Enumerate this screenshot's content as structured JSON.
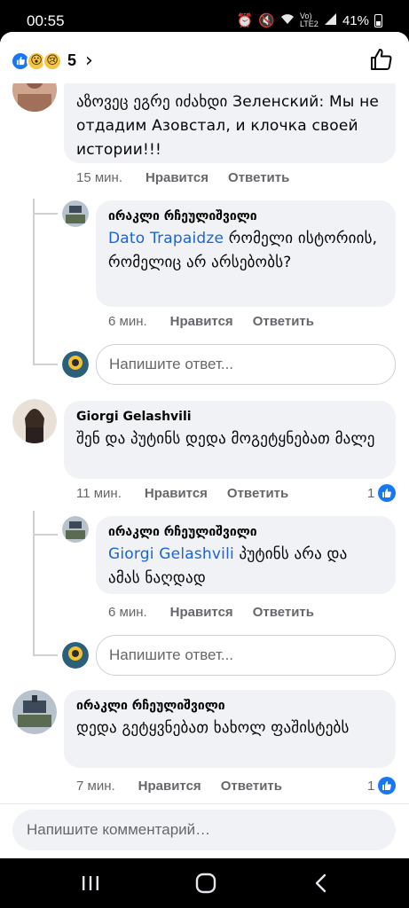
{
  "status": {
    "time": "00:55",
    "battery": "41%",
    "network": "Vo) LTE2"
  },
  "header": {
    "reaction_count": "5",
    "chevron": "›"
  },
  "comments": [
    {
      "text": "აზოვეც ეგრე იძახდი Зеленский: Мы не отдадим Азовстал, и клочка своей истории!!!",
      "time": "15 мин.",
      "like": "Нравится",
      "reply": "Ответить"
    },
    {
      "author": "ირაკლი რჩეულიშვილი",
      "mention": "Dato Trapaidze",
      "text": " რომელი ისტორიის, რომელიც არ არსებობს?",
      "time": "6 мин.",
      "like": "Нравится",
      "reply": "Ответить"
    },
    {
      "author": "Giorgi Gelashvili",
      "text": "შენ და პუტინს დედა მოგეტყნებათ მალე",
      "time": "11 мин.",
      "like": "Нравится",
      "reply": "Ответить",
      "likes": "1"
    },
    {
      "author": "ირაკლი რჩეულიშვილი",
      "mention": "Giorgi Gelashvili",
      "text": " პუტინს არა და ამას ნაღდად",
      "time": "6 мин.",
      "like": "Нравится",
      "reply": "Ответить"
    },
    {
      "author": "ირაკლი რჩეულიშვილი",
      "text": "დედა გეტყვნებათ ხახოლ ფაშისტებს",
      "time": "7 мин.",
      "like": "Нравится",
      "reply": "Ответить",
      "likes": "1"
    }
  ],
  "reply_placeholder": "Напишите ответ...",
  "comment_placeholder": "Напишите комментарий…",
  "colors": {
    "accent": "#1877f2",
    "mention": "#1b64d6",
    "bubble": "#f0f2f5"
  }
}
